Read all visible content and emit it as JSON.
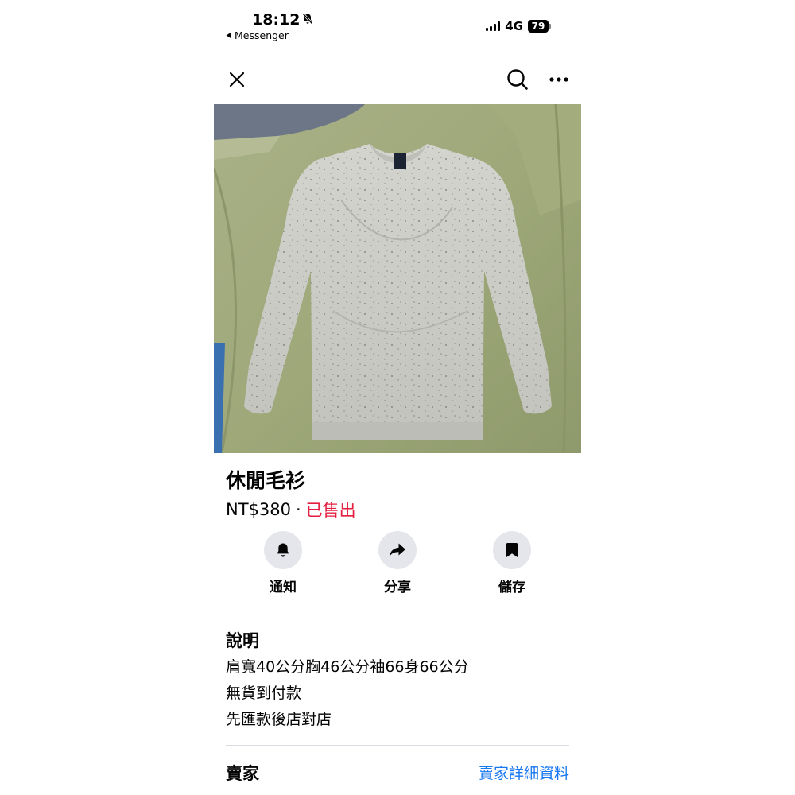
{
  "status_bar": {
    "time": "18:12",
    "back_app": "Messenger",
    "network": "4G",
    "battery": "79"
  },
  "nav": {
    "icons": [
      "close-icon",
      "search-icon",
      "more-icon"
    ]
  },
  "listing": {
    "title": "休閒毛衫",
    "price": "NT$380",
    "separator": "·",
    "status": "已售出",
    "photo_pages": 4,
    "active_photo": 1
  },
  "actions": [
    {
      "label": "通知",
      "icon": "bell-icon"
    },
    {
      "label": "分享",
      "icon": "share-icon"
    },
    {
      "label": "儲存",
      "icon": "bookmark-icon"
    }
  ],
  "description": {
    "heading": "說明",
    "lines": [
      "肩寬40公分胸46公分袖66身66公分",
      "無貨到付款",
      "先匯款後店對店"
    ]
  },
  "seller": {
    "heading": "賣家",
    "link": "賣家詳細資料"
  },
  "colors": {
    "sold": "#e41e3f",
    "link": "#1877f2",
    "action_bg": "#e4e6eb"
  }
}
